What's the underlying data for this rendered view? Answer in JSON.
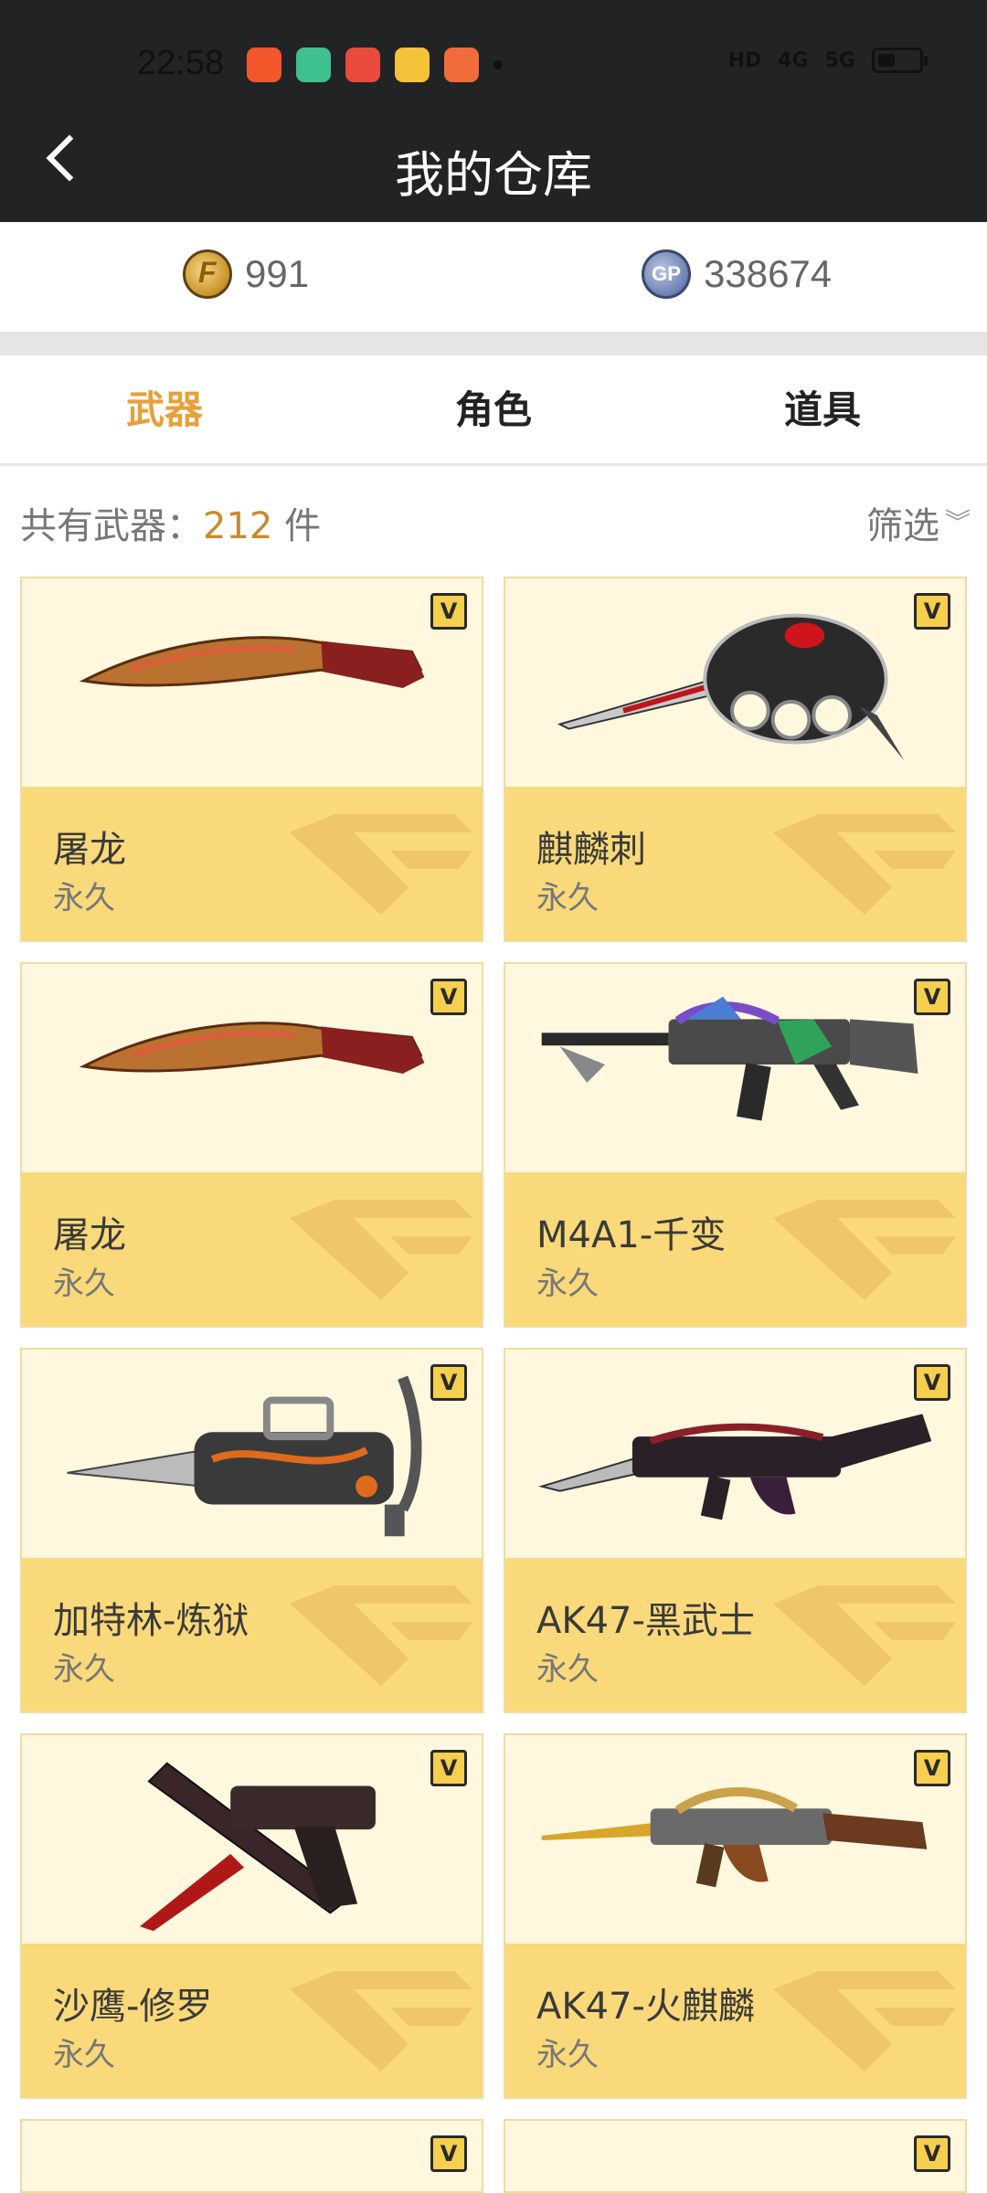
{
  "status": {
    "time": "22:58",
    "app_colors": [
      "#f2562b",
      "#3ec08f",
      "#e84a3c",
      "#f6c23a",
      "#f26b3a"
    ],
    "signal_labels": [
      "HD",
      "4G",
      "5G"
    ]
  },
  "header": {
    "title": "我的仓库"
  },
  "currency": {
    "cf_points": "991",
    "gp_label": "GP",
    "gp_points": "338674"
  },
  "tabs": [
    {
      "label": "武器",
      "active": true
    },
    {
      "label": "角色",
      "active": false
    },
    {
      "label": "道具",
      "active": false
    }
  ],
  "summary": {
    "label": "共有武器：",
    "count": "212",
    "unit": "件",
    "filter_label": "筛选"
  },
  "vip_mark": "V",
  "weapons": [
    {
      "name": "屠龙",
      "duration": "永久",
      "icon": "kukri-knife-icon"
    },
    {
      "name": "麒麟刺",
      "duration": "永久",
      "icon": "knuckle-blade-icon"
    },
    {
      "name": "屠龙",
      "duration": "永久",
      "icon": "kukri-knife-icon"
    },
    {
      "name": "M4A1-千变",
      "duration": "永久",
      "icon": "rifle-icon"
    },
    {
      "name": "加特林-炼狱",
      "duration": "永久",
      "icon": "gatling-gun-icon"
    },
    {
      "name": "AK47-黑武士",
      "duration": "永久",
      "icon": "rifle-icon"
    },
    {
      "name": "沙鹰-修罗",
      "duration": "永久",
      "icon": "pistol-icon"
    },
    {
      "name": "AK47-火麒麟",
      "duration": "永久",
      "icon": "rifle-icon"
    }
  ],
  "colors": {
    "accent": "#e8a03c",
    "card_bg": "#fff8df",
    "card_footer": "#f9d97a",
    "header_bg": "#222325"
  }
}
